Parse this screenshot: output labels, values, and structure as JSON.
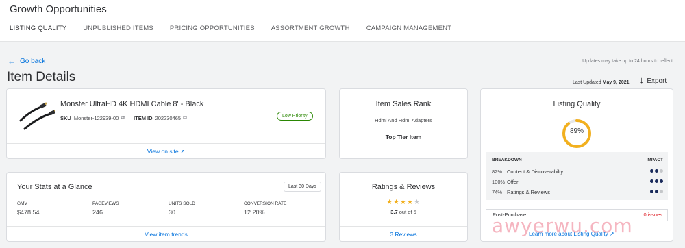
{
  "header": {
    "title": "Growth Opportunities",
    "tabs": [
      {
        "label": "LISTING QUALITY",
        "active": true
      },
      {
        "label": "UNPUBLISHED ITEMS",
        "active": false
      },
      {
        "label": "PRICING OPPORTUNITIES",
        "active": false
      },
      {
        "label": "ASSORTMENT GROWTH",
        "active": false
      },
      {
        "label": "CAMPAIGN MANAGEMENT",
        "active": false
      }
    ]
  },
  "nav": {
    "back_label": "Go back",
    "update_note": "Updates may take up to 24 hours to reflect"
  },
  "page": {
    "title": "Item Details",
    "last_updated_label": "Last Updated",
    "last_updated_date": "May 9, 2021",
    "export_label": "Export"
  },
  "product": {
    "name": "Monster UltraHD 4K HDMI Cable 8' - Black",
    "sku_label": "SKU",
    "sku": "Monster-122939-00",
    "item_id_label": "ITEM ID",
    "item_id": "202230465",
    "priority": "Low Priority",
    "view_link": "View on site"
  },
  "sales_rank": {
    "title": "Item Sales Rank",
    "category": "Hdmi And Hdmi Adapters",
    "tier": "Top Tier Item"
  },
  "listing_quality": {
    "title": "Listing Quality",
    "score_label": "89%",
    "score": 89,
    "breakdown_label": "BREAKDOWN",
    "impact_label": "IMPACT",
    "rows": [
      {
        "pct": "82%",
        "name": "Content & Discoverabilty",
        "impact": 2
      },
      {
        "pct": "100%",
        "name": "Offer",
        "impact": 3
      },
      {
        "pct": "74%",
        "name": "Ratings & Reviews",
        "impact": 2
      }
    ],
    "post_purchase_label": "Post-Purchase",
    "post_purchase_issues": "0 issues",
    "learn_more": "Learn more about Listing Quality"
  },
  "stats": {
    "title": "Your Stats at a Glance",
    "range": "Last 30 Days",
    "gmv_label": "GMV",
    "gmv": "$478.54",
    "pageviews_label": "PAGEVIEWS",
    "pageviews": "246",
    "units_label": "UNITS SOLD",
    "units": "30",
    "conversion_label": "CONVERSION RATE",
    "conversion": "12.20%",
    "trends_link": "View item trends"
  },
  "ratings": {
    "title": "Ratings & Reviews",
    "stars": 4,
    "value": "3.7",
    "out_of": "out of 5",
    "reviews_link": "3 Reviews"
  },
  "watermark": "awyerwu.com",
  "colors": {
    "accent": "#0071dc",
    "ring": "#f2b01e",
    "impact_dot": "#1a2b5c",
    "priority_green": "#2a8703",
    "issues_red": "#de1c24"
  }
}
